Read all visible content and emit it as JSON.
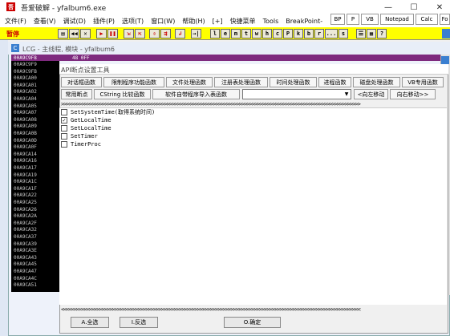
{
  "window": {
    "title": "吾爱破解 - yfalbum6.exe",
    "icon": "吾",
    "minimize": "—",
    "maximize": "☐",
    "close": "✕"
  },
  "menubar": {
    "items": [
      "文件(F)",
      "查看(V)",
      "调试(D)",
      "插件(P)",
      "选项(T)",
      "窗口(W)",
      "帮助(H)",
      "[+]",
      "快捷菜单",
      "Tools",
      "BreakPoint-"
    ],
    "right_buttons": [
      "BP",
      "P",
      "VB",
      "Notepad",
      "Calc",
      "Fo"
    ]
  },
  "toolbar": {
    "status": "暂停",
    "buttons": [
      "▤",
      "◀◀",
      "✕",
      "▶",
      "❚❚",
      "⇲",
      "⇱",
      "⇳",
      "⇶",
      "↲",
      "→|",
      "l",
      "e",
      "m",
      "t",
      "w",
      "h",
      "c",
      "P",
      "k",
      "b",
      "r",
      "...",
      "s",
      "☰",
      "▦",
      "?"
    ]
  },
  "cpu": {
    "title": "LCG - 主线程, 模块 - yfalbum6",
    "icon": "C",
    "top_row_addr": "00A9C9F8",
    "top_row_hex": "48   0FF",
    "addresses": [
      "00A9C9F9",
      "00A9C9FB",
      "00A9CA00",
      "00A9CA01",
      "00A9CA02",
      "00A9CA04",
      "00A9CA05",
      "00A9CA07",
      "00A9CA08",
      "00A9CA09",
      "00A9CA0B",
      "00A9CA0D",
      "00A9CA0F",
      "00A9CA14",
      "00A9CA16",
      "00A9CA17",
      "00A9CA19",
      "00A9CA1C",
      "00A9CA1F",
      "00A9CA22",
      "00A9CA25",
      "00A9CA26",
      "00A9CA2A",
      "00A9CA2F",
      "00A9CA32",
      "00A9CA37",
      "00A9CA39",
      "00A9CA3E",
      "00A9CA43",
      "00A9CA45",
      "00A9CA47",
      "00A9CA4C",
      "00A9CA51"
    ]
  },
  "dialog": {
    "title": "API断点设置工具",
    "tabs": [
      "对话框函数",
      "限制程序功能函数",
      "文件处理函数",
      "注册表处理函数",
      "时间处理函数",
      "进程函数",
      "磁盘处理函数",
      "VB专用函数"
    ],
    "row2": {
      "common": "常用断点",
      "cstring": "CString 比较函数",
      "import_table": "软件自带程序导入表函数",
      "combo_value": "",
      "move_left": "<向左移动",
      "move_right": "向右移动>>"
    },
    "top_chevrons": ">>>>>>>>>>>>>>>>>>>>>>>>>>>>>>>>>>>>>>>>>>>>>>>>>>>>>>>>>>>>>>>>>>>>>>>>>>>>>>>>>>>>>>>>>>>>>>>>>>>>>>>>>>>>>>>>>>>>",
    "bottom_chevrons": "<<<<<<<<<<<<<<<<<<<<<<<<<<<<<<<<<<<<<<<<<<<<<<<<<<<<<<<<<<<<<<<<<<<<<<<<<<<<<<<<<<<<<<<<<<<<<<<<<<<<<<<<<<<<<<<<<<<<",
    "items": [
      {
        "label": "SetSystemTime(取得系统时间)",
        "checked": false
      },
      {
        "label": "GetLocalTime",
        "checked": true
      },
      {
        "label": "SetLocalTime",
        "checked": false
      },
      {
        "label": "SetTimer",
        "checked": false
      },
      {
        "label": "TimerProc",
        "checked": false
      }
    ],
    "buttons": {
      "select_all": "A.全选",
      "invert": "I.反选",
      "ok": "O.确定"
    }
  }
}
